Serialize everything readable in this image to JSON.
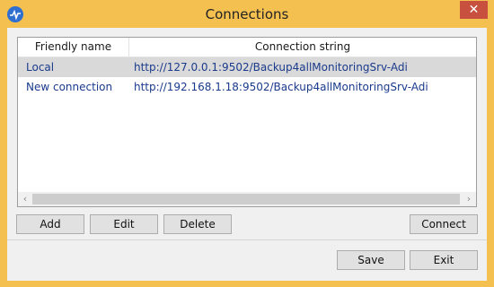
{
  "window": {
    "title": "Connections",
    "close_glyph": "✕"
  },
  "grid": {
    "columns": [
      "Friendly name",
      "Connection string"
    ],
    "rows": [
      {
        "name": "Local",
        "conn": "http://127.0.0.1:9502/Backup4allMonitoringSrv-Adi",
        "selected": true
      },
      {
        "name": "New connection",
        "conn": "http://192.168.1.18:9502/Backup4allMonitoringSrv-Adi",
        "selected": false
      }
    ],
    "scroll_left": "‹",
    "scroll_right": "›"
  },
  "buttons": {
    "add": "Add",
    "edit": "Edit",
    "delete": "Delete",
    "connect": "Connect",
    "save": "Save",
    "exit": "Exit"
  },
  "icons": {
    "app": "heartbeat-icon",
    "close": "close-icon"
  },
  "colors": {
    "frame": "#f4c04f",
    "close": "#c7503f",
    "link_text": "#1a3a8c",
    "selected_row": "#d9d9d9"
  }
}
